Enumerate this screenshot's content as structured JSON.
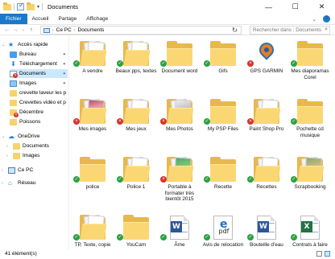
{
  "window": {
    "title": "Documents",
    "controls": [
      "—",
      "☐",
      "✕"
    ]
  },
  "ribbon": {
    "tabs": [
      "Fichier",
      "Accueil",
      "Partage",
      "Affichage"
    ],
    "help": "?"
  },
  "address": {
    "path": [
      "Ce PC",
      "Documents"
    ],
    "search_placeholder": "Rechercher dans : Documents"
  },
  "sidebar": {
    "items": [
      {
        "label": "Accès rapide",
        "icon": "star-icon"
      },
      {
        "label": "Bureau",
        "icon": "desktop-icon",
        "pinned": true
      },
      {
        "label": "Téléchargement",
        "icon": "download-icon",
        "pinned": true
      },
      {
        "label": "Documents",
        "icon": "documents-icon",
        "pinned": true,
        "selected": true
      },
      {
        "label": "Images",
        "icon": "pictures-icon",
        "pinned": true
      },
      {
        "label": "crevette laveur les p",
        "icon": "folder-icon"
      },
      {
        "label": "Crevettes vidéo et p",
        "icon": "folder-icon"
      },
      {
        "label": "Décembre",
        "icon": "folder-icon"
      },
      {
        "label": "Poissons",
        "icon": "folder-icon"
      },
      {
        "label": "OneDrive",
        "icon": "onedrive-icon"
      },
      {
        "label": "Documents",
        "icon": "folder-icon"
      },
      {
        "label": "Images",
        "icon": "folder-icon"
      },
      {
        "label": "Ce PC",
        "icon": "this-pc-icon"
      },
      {
        "label": "Réseau",
        "icon": "network-icon"
      }
    ]
  },
  "files": [
    {
      "name": "A vendre",
      "type": "folder-docs",
      "status": "ok"
    },
    {
      "name": "Beaux pps, textes",
      "type": "folder-docs",
      "status": "ok"
    },
    {
      "name": "Document word",
      "type": "folder",
      "status": "ok"
    },
    {
      "name": "Gifs",
      "type": "folder",
      "status": "ok"
    },
    {
      "name": "GPS GARMIN",
      "type": "gps",
      "status": "error"
    },
    {
      "name": "Mes diaporamas Corel",
      "type": "folder",
      "status": "ok"
    },
    {
      "name": "Mes images",
      "type": "folder-photo1",
      "status": "error"
    },
    {
      "name": "Mes jeux",
      "type": "folder-docs",
      "status": "error"
    },
    {
      "name": "Mes Photos",
      "type": "folder-photo2",
      "status": "error"
    },
    {
      "name": "My PSP Files",
      "type": "folder",
      "status": "ok"
    },
    {
      "name": "Paint Shop Pro",
      "type": "folder-docs",
      "status": "error"
    },
    {
      "name": "Pochette cd musique",
      "type": "folder",
      "status": "ok"
    },
    {
      "name": "police",
      "type": "folder",
      "status": "ok"
    },
    {
      "name": "Police 1",
      "type": "folder-docs",
      "status": "ok"
    },
    {
      "name": "Portable à formater très bientôt 2015",
      "type": "folder-photo4",
      "status": "error"
    },
    {
      "name": "Recette",
      "type": "folder",
      "status": "ok"
    },
    {
      "name": "Recettes",
      "type": "folder-docs",
      "status": "ok"
    },
    {
      "name": "Scrapbooking",
      "type": "folder-photo3",
      "status": "ok"
    },
    {
      "name": "TP, Texte, copie",
      "type": "folder-docs",
      "status": "ok"
    },
    {
      "name": "YouCam",
      "type": "folder",
      "status": "ok"
    },
    {
      "name": "Âme",
      "type": "word",
      "status": "ok"
    },
    {
      "name": "Avis de relocation",
      "type": "pdf",
      "status": "ok"
    },
    {
      "name": "Bouteille d'eau",
      "type": "word",
      "status": "ok"
    },
    {
      "name": "Contrats à faire",
      "type": "excel",
      "status": "ok"
    }
  ],
  "statusbar": {
    "count": "41 élément(s)"
  }
}
